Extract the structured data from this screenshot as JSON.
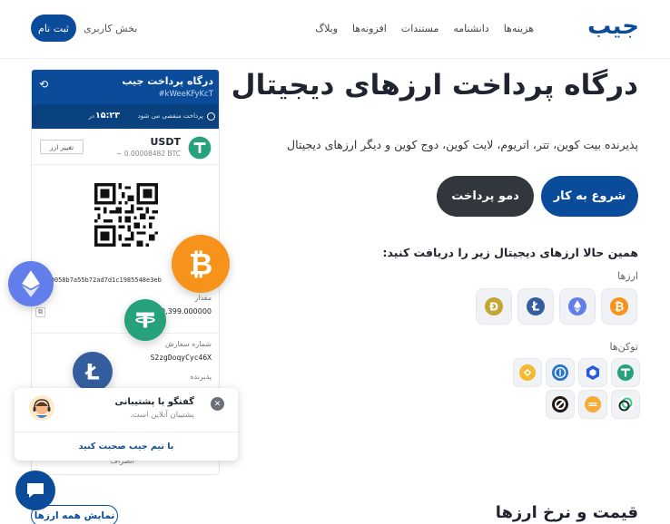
{
  "header": {
    "logo": "جیب",
    "nav": [
      "هزینه‌ها",
      "دانشنامه",
      "مستندات",
      "افزونه‌ها",
      "وبلاگ"
    ],
    "user_area": "بخش کاربری",
    "signup": "ثبت نام"
  },
  "hero": {
    "title": "درگاه پرداخت ارزهای دیجیتال",
    "subtitle": "پذیرنده بیت کوین، تتر، اتریوم، لایت کوین، دوج کوین و دیگر ارزهای دیجیتال",
    "start_button": "شروع به کار",
    "demo_button": "دمو پرداخت",
    "receive_title": "همین حالا ارزهای دیجیتال زیر را دریافت کنید:",
    "currencies_label": "ارزها",
    "tokens_label": "توکن‌ها"
  },
  "coins": [
    "bitcoin-icon",
    "ethereum-icon",
    "litecoin-icon",
    "dogecoin-icon"
  ],
  "tokens_row1": [
    "tether-icon",
    "chainlink-icon",
    "usdc-icon",
    "bnb-icon"
  ],
  "tokens_row2": [
    "celo-icon",
    "dai-icon",
    "0x-icon"
  ],
  "gateway": {
    "title": "درگاه پرداخت جیب",
    "ref": "#kWeeKFyKcT",
    "timer_value": "۱۵:۲۳",
    "timer_prefix": "در",
    "timer_suffix": "پرداخت منقضی می شود",
    "coin_name": "USDT",
    "coin_rate": "~ 0.00008482 BTC",
    "change_button": "تغییر ارز",
    "address": "0x00058b7a55b72ad7d1c1985548e3eb",
    "amount_label": "مقدار",
    "amount_value": "10,399.000000",
    "order_label": "شماره سفارش",
    "order_value": "S2zgDoqyCyc46X",
    "receiver_label": "پذیرنده",
    "cancel_label": "انصراف"
  },
  "chat": {
    "title": "گفتگو با پشتیبانی",
    "status": "پشتیبان آنلاین است.",
    "cta": "با تیم جیب صحبت کنید"
  },
  "prices": {
    "title": "قیمت و نرخ ارزها",
    "show_all": "نمایش همه ارزها"
  },
  "colors": {
    "brand": "#0b4c9a",
    "dark_button": "#32363d",
    "bitcoin": "#f7931a",
    "ethereum": "#627eea",
    "tether": "#26a17b",
    "litecoin": "#345d9d"
  }
}
